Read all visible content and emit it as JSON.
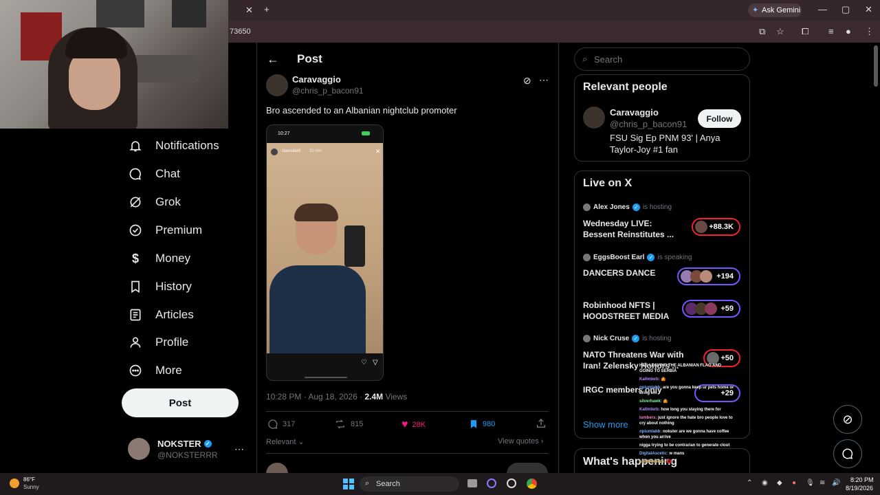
{
  "browser": {
    "address_fragment": "73650",
    "ask_gemini": "Ask Gemini"
  },
  "nav": {
    "items": [
      {
        "label": "Notifications",
        "icon": "bell-icon",
        "glyph": "🔔"
      },
      {
        "label": "Chat",
        "icon": "chat-icon",
        "glyph": "💬"
      },
      {
        "label": "Grok",
        "icon": "grok-icon",
        "glyph": "⊘"
      },
      {
        "label": "Premium",
        "icon": "premium-icon",
        "glyph": "✓"
      },
      {
        "label": "Money",
        "icon": "money-icon",
        "glyph": "$"
      },
      {
        "label": "History",
        "icon": "bookmark-icon",
        "glyph": "🔖"
      },
      {
        "label": "Articles",
        "icon": "articles-icon",
        "glyph": "≡"
      },
      {
        "label": "Profile",
        "icon": "profile-icon",
        "glyph": "👤"
      },
      {
        "label": "More",
        "icon": "more-icon",
        "glyph": "⋯"
      }
    ],
    "post_label": "Post",
    "account": {
      "name": "NOKSTER",
      "handle": "@NOKSTERRR"
    }
  },
  "post": {
    "header": "Post",
    "author_name": "Caravaggio",
    "author_handle": "@chris_p_bacon91",
    "text": "Bro ascended to an Albanian nightclub promoter",
    "story": {
      "time": "10:27",
      "user": "clavsular0",
      "ago": "32 min"
    },
    "timestamp": "10:28 PM · Aug 18, 2026 · ",
    "views_count": "2.4M",
    "views_label": " Views",
    "replies": "317",
    "reposts": "815",
    "likes": "28K",
    "bookmarks": "980",
    "sort_label": "Relevant",
    "view_quotes": "View quotes"
  },
  "right": {
    "search_placeholder": "Search",
    "relevant_title": "Relevant people",
    "person": {
      "name": "Caravaggio",
      "handle": "@chris_p_bacon91",
      "bio": "FSU Sig Ep PNM 93' | Anya Taylor-Joy #1 fan",
      "follow_label": "Follow"
    },
    "live_title": "Live on X",
    "live": [
      {
        "host": "Alex Jones",
        "status": "is hosting",
        "title": "Wednesday LIVE: Bessent Reinstitutes ...",
        "count": "+88.3K"
      },
      {
        "host": "EggsBoost Earl",
        "status": "is speaking",
        "title": "DANCERS DANCE",
        "count": "+194"
      },
      {
        "host": "",
        "status": "",
        "title": "Robinhood NFTS | HOODSTREET MEDIA",
        "count": "+59"
      },
      {
        "host": "Nick Cruse",
        "status": "is hosting",
        "title": "NATO Threatens War with Iran! Zelensky Honors ...",
        "count": "+50"
      },
      {
        "host": "",
        "status": "",
        "title": "IRGC members only",
        "count": "+29"
      }
    ],
    "show_more": "Show more",
    "happening_title": "What's happening"
  },
  "chat": [
    {
      "user": "",
      "msg": "HES LEAVING THE ALBANIAN FLAG AND GOING TO SERBIA"
    },
    {
      "user": "Kallmterb:",
      "msg": "🤷"
    },
    {
      "user": "opiumlabb:",
      "msg": "are you gonna keep ur pets home or bring em"
    },
    {
      "user": "silverhawk:",
      "msg": "🤷"
    },
    {
      "user": "Kallmterb:",
      "msg": "how long you staying there for"
    },
    {
      "user": "lumbers:",
      "msg": "just ignore the hate bro people love to cry about nothing"
    },
    {
      "user": "opiumlabb:",
      "msg": "nokster are we gonna have coffee when you arrive"
    },
    {
      "user": "",
      "msg": "nigga trying to be contrarian to generate clout"
    },
    {
      "user": "DigitalAscetic:",
      "msg": "w mans"
    },
    {
      "user": "swiff7breeze:",
      "msg": "🇦🇱"
    }
  ],
  "taskbar": {
    "temp": "86°F",
    "weather": "Sunny",
    "search_label": "Search",
    "time": "8:20 PM",
    "date": "8/19/2026"
  },
  "colors": {
    "accent": "#1d9bf0",
    "like": "#f91880",
    "bookmark": "#1d9bf0",
    "live_ring": "#f4212e",
    "live_ring_purple": "#7856ff"
  }
}
